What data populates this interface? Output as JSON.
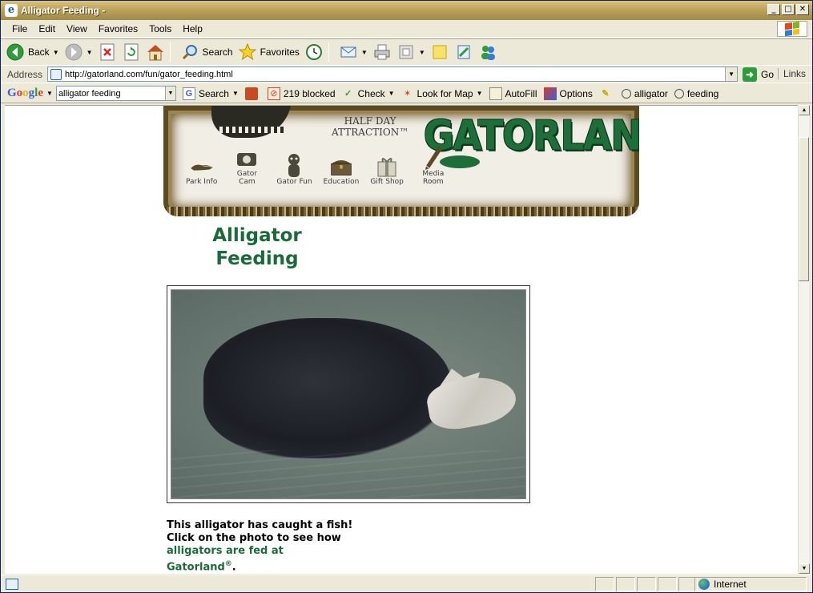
{
  "window": {
    "title": "Alligator Feeding -",
    "controls": [
      "_",
      "□",
      "✕"
    ]
  },
  "menu": {
    "items": [
      "File",
      "Edit",
      "View",
      "Favorites",
      "Tools",
      "Help"
    ]
  },
  "toolbar": {
    "back": "Back",
    "search": "Search",
    "favorites": "Favorites"
  },
  "address": {
    "label": "Address",
    "url": "http://gatorland.com/fun/gator_feeding.html",
    "go": "Go",
    "links": "Links"
  },
  "google": {
    "query": "alligator feeding",
    "search": "Search",
    "blocked": "219 blocked",
    "check": "Check",
    "look_for_map": "Look for Map",
    "autofill": "AutoFill",
    "options": "Options",
    "term1": "alligator",
    "term2": "feeding"
  },
  "banner": {
    "tagline_1": "HALF DAY",
    "tagline_2": "ATTRACTION™",
    "logo": "GATORLAND",
    "nav": [
      {
        "label": "Park Info",
        "icon": "gator-icon"
      },
      {
        "label": "Gator Cam",
        "icon": "camera-icon"
      },
      {
        "label": "Gator Fun",
        "icon": "mascot-icon"
      },
      {
        "label": "Education",
        "icon": "chest-icon"
      },
      {
        "label": "Gift Shop",
        "icon": "gift-box-icon"
      },
      {
        "label": "Media Room",
        "icon": "pen-icon"
      }
    ]
  },
  "page": {
    "title_line1": "Alligator",
    "title_line2": "Feeding",
    "caption_line1": "This alligator has caught a fish!",
    "caption_line2": "Click on the photo to see how",
    "caption_link1": "alligators are fed at",
    "caption_link2": "Gatorland",
    "caption_mark": "®",
    "caption_end": "."
  },
  "status": {
    "zone": "Internet"
  },
  "colors": {
    "brand_green": "#1B6B3A",
    "titlebar": "#B9A15A"
  }
}
